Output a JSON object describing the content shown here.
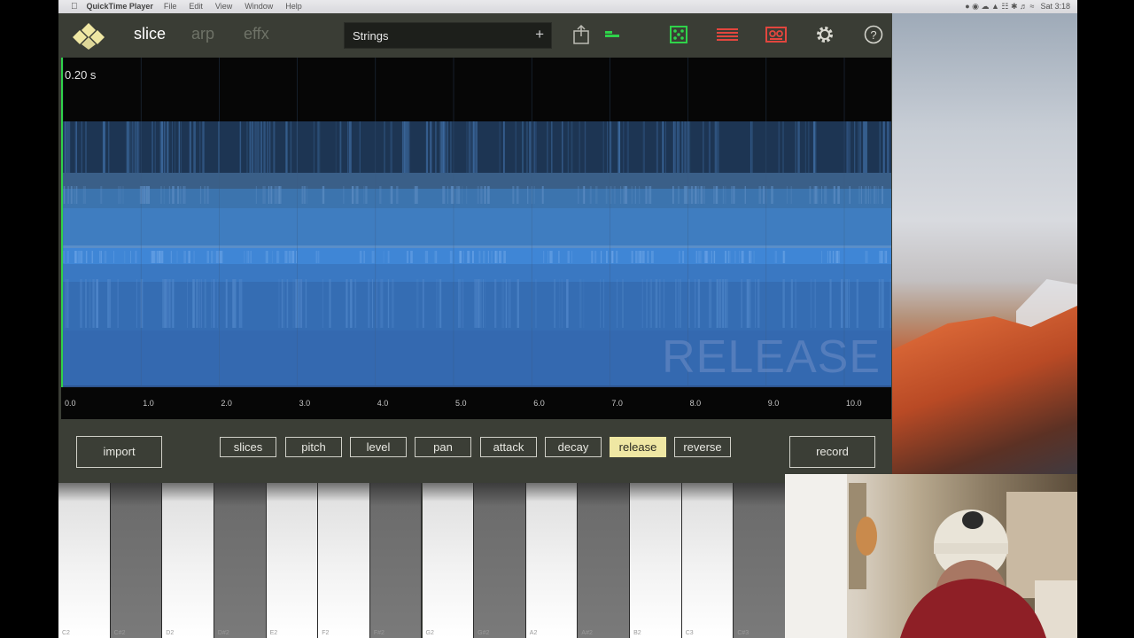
{
  "menubar": {
    "app_name": "QuickTime Player",
    "menus": [
      "File",
      "Edit",
      "View",
      "Window",
      "Help"
    ],
    "clock": "Sat 3:18"
  },
  "topbar": {
    "tabs": [
      "slice",
      "arp",
      "effx"
    ],
    "active_tab": "slice",
    "preset": "Strings",
    "preset_add": "+",
    "icons": [
      "share-icon",
      "level-icon",
      "dice-icon",
      "lines-icon",
      "tape-icon",
      "gear-icon",
      "help-icon"
    ],
    "colors": {
      "accent_green": "#2fd24a",
      "accent_red": "#e2463e",
      "panel": "#3b3e36"
    }
  },
  "waveform": {
    "time_readout": "0.20 s",
    "mode_overlay": "RELEASE",
    "ticks": [
      "0.0",
      "1.0",
      "2.0",
      "3.0",
      "4.0",
      "5.0",
      "6.0",
      "7.0",
      "8.0",
      "9.0",
      "10.0"
    ]
  },
  "params": {
    "import": "import",
    "record": "record",
    "buttons": [
      "slices",
      "pitch",
      "level",
      "pan",
      "attack",
      "decay",
      "release",
      "reverse"
    ],
    "active": "release"
  },
  "keyboard": {
    "labels": [
      "C2",
      "C#2",
      "D2",
      "D#2",
      "E2",
      "F2",
      "F#2",
      "G2",
      "G#2",
      "A2",
      "A#2",
      "B2",
      "C3",
      "C#3"
    ]
  }
}
